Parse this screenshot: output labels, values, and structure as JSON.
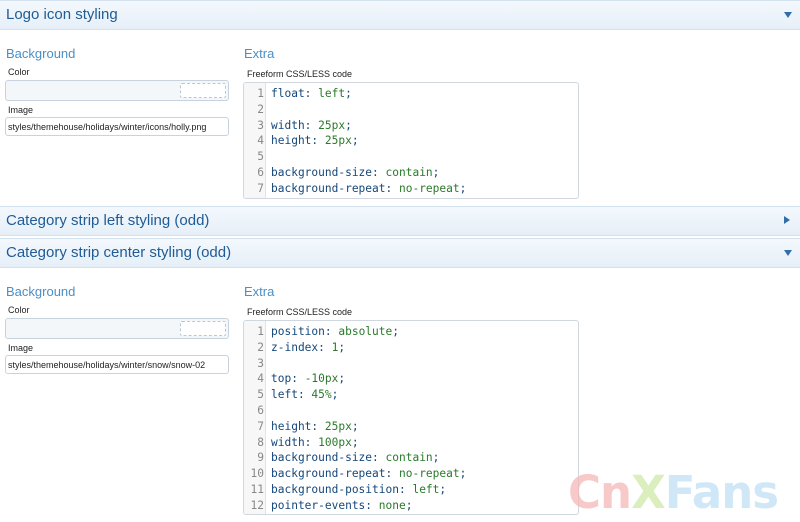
{
  "sections": [
    {
      "title": "Logo icon styling",
      "expanded": true
    },
    {
      "title": "Category strip left styling (odd)",
      "expanded": false
    },
    {
      "title": "Category strip center styling (odd)",
      "expanded": true
    }
  ],
  "logo_icon": {
    "background_heading": "Background",
    "color_label": "Color",
    "color_value": "",
    "image_label": "Image",
    "image_value": "styles/themehouse/holidays/winter/icons/holly.png",
    "extra_heading": "Extra",
    "css_label": "Freeform CSS/LESS code",
    "code": [
      {
        "n": "1",
        "prop": "float",
        "val": "left"
      },
      {
        "n": "2",
        "prop": "",
        "val": ""
      },
      {
        "n": "3",
        "prop": "width",
        "val": "25px"
      },
      {
        "n": "4",
        "prop": "height",
        "val": "25px"
      },
      {
        "n": "5",
        "prop": "",
        "val": ""
      },
      {
        "n": "6",
        "prop": "background-size",
        "val": "contain"
      },
      {
        "n": "7",
        "prop": "background-repeat",
        "val": "no-repeat"
      }
    ]
  },
  "center_strip": {
    "background_heading": "Background",
    "color_label": "Color",
    "color_value": "",
    "image_label": "Image",
    "image_value": "styles/themehouse/holidays/winter/snow/snow-02",
    "extra_heading": "Extra",
    "css_label": "Freeform CSS/LESS code",
    "code": [
      {
        "n": "1",
        "prop": "position",
        "val": "absolute"
      },
      {
        "n": "2",
        "prop": "z-index",
        "val": "1"
      },
      {
        "n": "3",
        "prop": "",
        "val": ""
      },
      {
        "n": "4",
        "prop": "top",
        "val": "-10px"
      },
      {
        "n": "5",
        "prop": "left",
        "val": "45%"
      },
      {
        "n": "6",
        "prop": "",
        "val": ""
      },
      {
        "n": "7",
        "prop": "height",
        "val": "25px"
      },
      {
        "n": "8",
        "prop": "width",
        "val": "100px"
      },
      {
        "n": "9",
        "prop": "background-size",
        "val": "contain"
      },
      {
        "n": "10",
        "prop": "background-repeat",
        "val": "no-repeat"
      },
      {
        "n": "11",
        "prop": "background-position",
        "val": "left"
      },
      {
        "n": "12",
        "prop": "pointer-events",
        "val": "none"
      }
    ]
  },
  "watermark": {
    "part1": "Cn",
    "part2": "X",
    "part3": "Fans"
  }
}
